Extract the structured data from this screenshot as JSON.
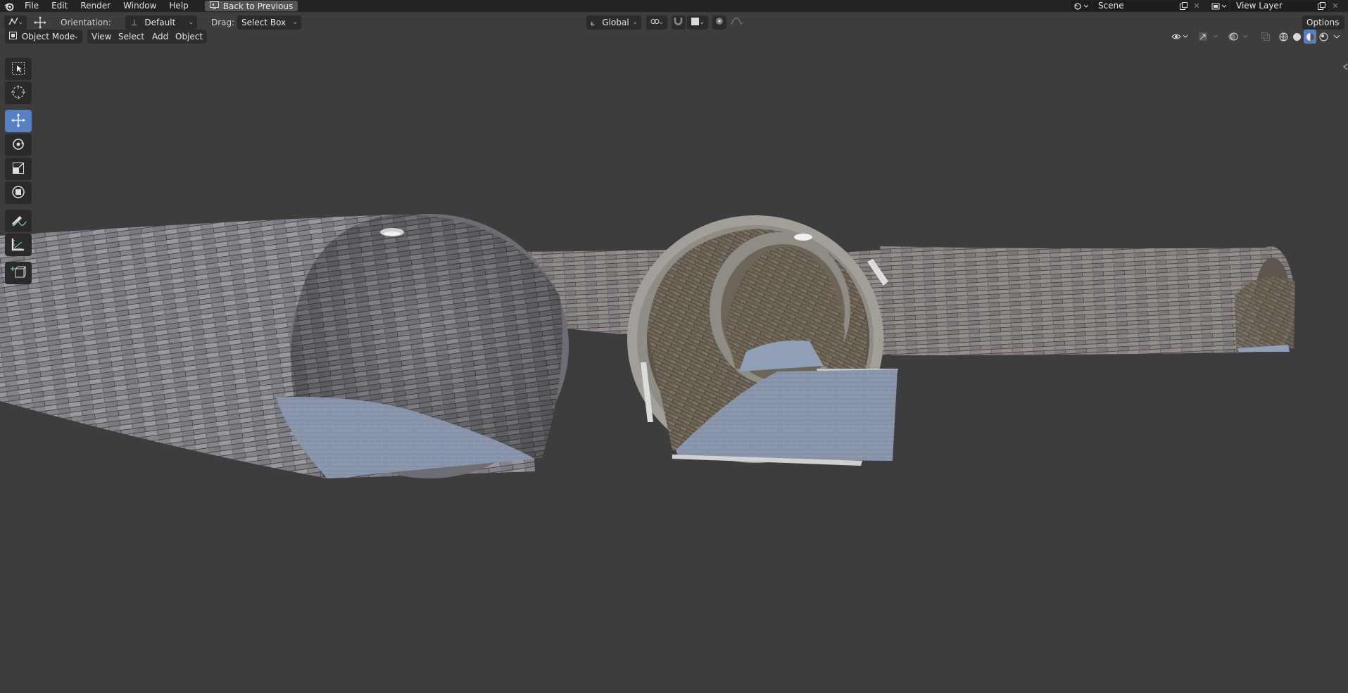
{
  "menu": {
    "file": "File",
    "edit": "Edit",
    "render": "Render",
    "window": "Window",
    "help": "Help",
    "back_to_previous": "Back to Previous"
  },
  "scene": {
    "name": "Scene"
  },
  "view_layer": {
    "name": "View Layer"
  },
  "tool_header": {
    "orientation_label": "Orientation:",
    "orientation_value": "Default",
    "drag_label": "Drag:",
    "drag_value": "Select Box",
    "transform_orientation": "Global",
    "options": "Options"
  },
  "viewport_header": {
    "mode": "Object Mode",
    "view": "View",
    "select": "Select",
    "add": "Add",
    "object": "Object"
  },
  "toolbar": {
    "tools": [
      {
        "name": "select-box",
        "icon": "select-box-icon",
        "active": false
      },
      {
        "name": "cursor",
        "icon": "cursor-icon",
        "active": false
      },
      {
        "name": "move",
        "icon": "move-icon",
        "active": true
      },
      {
        "name": "rotate",
        "icon": "rotate-icon",
        "active": false
      },
      {
        "name": "scale",
        "icon": "scale-icon",
        "active": false
      },
      {
        "name": "transform",
        "icon": "transform-icon",
        "active": false
      },
      {
        "name": "annotate",
        "icon": "annotate-icon",
        "active": false
      },
      {
        "name": "measure",
        "icon": "measure-icon",
        "active": false
      },
      {
        "name": "add-cube",
        "icon": "add-cube-icon",
        "active": false
      }
    ]
  },
  "colors": {
    "topbar": "#232323",
    "viewport_bg": "#3d3d3d",
    "active_tool": "#5680c2",
    "tunnel_stone": "#8a8790",
    "tunnel_floor": "#8a96aa"
  },
  "viewport_objects": [
    "tunnel-left",
    "tunnel-center",
    "tunnel-background",
    "tunnel-right-end"
  ]
}
